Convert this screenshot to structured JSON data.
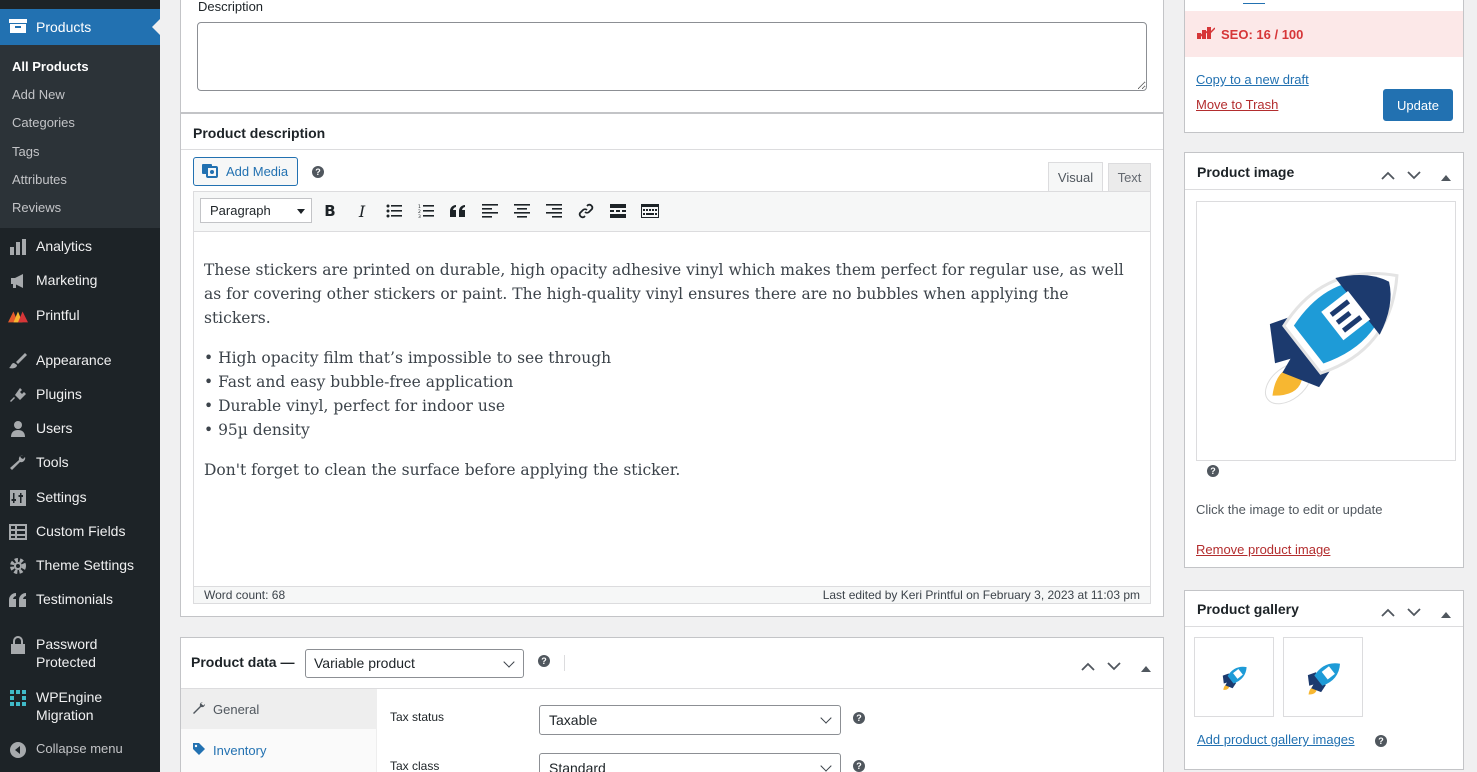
{
  "sidebar": {
    "products_label": "Products",
    "submenu": [
      "All Products",
      "Add New",
      "Categories",
      "Tags",
      "Attributes",
      "Reviews"
    ],
    "items": [
      {
        "label": "Analytics"
      },
      {
        "label": "Marketing"
      },
      {
        "label": "Printful"
      },
      {
        "label": "Appearance"
      },
      {
        "label": "Plugins"
      },
      {
        "label": "Users"
      },
      {
        "label": "Tools"
      },
      {
        "label": "Settings"
      },
      {
        "label": "Custom Fields"
      },
      {
        "label": "Theme Settings"
      },
      {
        "label": "Testimonials"
      },
      {
        "label": "Password Protected"
      },
      {
        "label": "WPEngine Migration"
      },
      {
        "label": "Collapse menu"
      }
    ]
  },
  "description_field": {
    "label": "Description",
    "value": ""
  },
  "editor": {
    "title": "Product description",
    "add_media": "Add Media",
    "tab_visual": "Visual",
    "tab_text": "Text",
    "format": "Paragraph",
    "paragraph1": "These stickers are printed on durable, high opacity adhesive vinyl which makes them perfect for regular use, as well as for covering other stickers or paint. The high-quality vinyl ensures there are no bubbles when applying the stickers.",
    "bullets": [
      "• High opacity film that’s impossible to see through",
      "• Fast and easy bubble-free application",
      "• Durable vinyl, perfect for indoor use",
      "• 95µ density"
    ],
    "paragraph2": "Don't forget to clean the surface before applying the sticker.",
    "word_count": "Word count: 68",
    "last_edited": "Last edited by Keri Printful on February 3, 2023 at 11:03 pm"
  },
  "product_data": {
    "title": "Product data —",
    "type": "Variable product",
    "tabs": [
      "General",
      "Inventory"
    ],
    "tax_status_label": "Tax status",
    "tax_status": "Taxable",
    "tax_class_label": "Tax class",
    "tax_class": "Standard"
  },
  "publish": {
    "seo": "SEO: 16 / 100",
    "copy_draft": "Copy to a new draft",
    "trash": "Move to Trash",
    "update": "Update"
  },
  "product_image": {
    "title": "Product image",
    "hint": "Click the image to edit or update",
    "remove": "Remove product image"
  },
  "gallery": {
    "title": "Product gallery",
    "add": "Add product gallery images"
  },
  "colors": {
    "accent": "#2271b1",
    "sidebar": "#1d2327",
    "danger": "#d63638"
  }
}
